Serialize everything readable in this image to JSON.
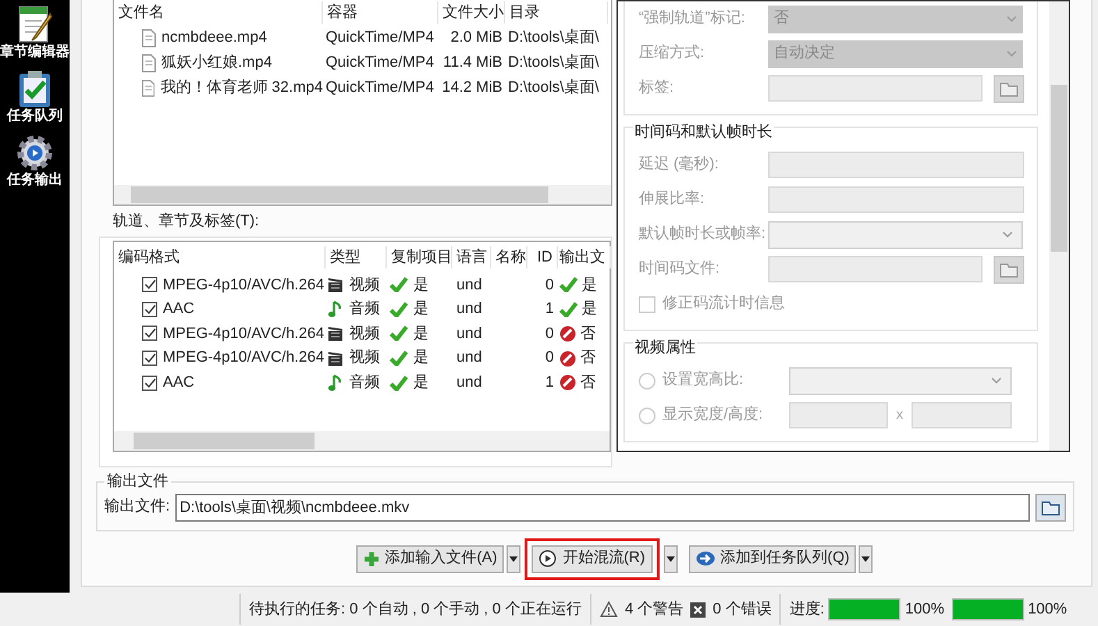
{
  "sidebar": {
    "items": [
      {
        "label": "章节编辑器",
        "kind": "notepad"
      },
      {
        "label": "任务队列",
        "kind": "queue"
      },
      {
        "label": "任务输出",
        "kind": "output"
      }
    ]
  },
  "files": {
    "columns": [
      "文件名",
      "容器",
      "文件大小",
      "目录"
    ],
    "rows": [
      {
        "name": "ncmbdeee.mp4",
        "container": "QuickTime/MP4",
        "size": "2.0 MiB",
        "dir": "D:\\tools\\桌面\\"
      },
      {
        "name": "狐妖小红娘.mp4",
        "container": "QuickTime/MP4",
        "size": "11.4 MiB",
        "dir": "D:\\tools\\桌面\\"
      },
      {
        "name": "我的！体育老师 32.mp4",
        "container": "QuickTime/MP4",
        "size": "14.2 MiB",
        "dir": "D:\\tools\\桌面\\"
      }
    ]
  },
  "tracks": {
    "label": "轨道、章节及标签(T):",
    "columns": [
      "编码格式",
      "类型",
      "复制项目",
      "语言",
      "名称",
      "ID",
      "输出文"
    ],
    "rows": [
      {
        "checked": true,
        "codec": "MPEG-4p10/AVC/h.264",
        "kind": "video",
        "type": "视频",
        "copy": "是",
        "copy_on": true,
        "language": "und",
        "id": "0",
        "output": "是",
        "output_on": true
      },
      {
        "checked": true,
        "codec": "AAC",
        "kind": "audio",
        "type": "音频",
        "copy": "是",
        "copy_on": true,
        "language": "und",
        "id": "1",
        "output": "是",
        "output_on": true
      },
      {
        "checked": true,
        "codec": "MPEG-4p10/AVC/h.264",
        "kind": "video",
        "type": "视频",
        "copy": "是",
        "copy_on": true,
        "language": "und",
        "id": "0",
        "output": "否",
        "output_on": false
      },
      {
        "checked": true,
        "codec": "MPEG-4p10/AVC/h.264",
        "kind": "video",
        "type": "视频",
        "copy": "是",
        "copy_on": true,
        "language": "und",
        "id": "0",
        "output": "否",
        "output_on": false
      },
      {
        "checked": true,
        "codec": "AAC",
        "kind": "audio",
        "type": "音频",
        "copy": "是",
        "copy_on": true,
        "language": "und",
        "id": "1",
        "output": "否",
        "output_on": false
      }
    ]
  },
  "properties": {
    "sections": [
      {
        "rows": [
          {
            "kind": "select",
            "label": "“强制轨道”标记:",
            "value": "否"
          },
          {
            "kind": "select",
            "label": "压缩方式:",
            "value": "自动决定"
          },
          {
            "kind": "file",
            "label": "标签:"
          }
        ]
      },
      {
        "title": "时间码和默认帧时长",
        "rows": [
          {
            "kind": "input",
            "label": "延迟 (毫秒):"
          },
          {
            "kind": "input",
            "label": "伸展比率:"
          },
          {
            "kind": "combo",
            "label": "默认帧时长或帧率:"
          },
          {
            "kind": "file",
            "label": "时间码文件:"
          },
          {
            "kind": "checkbox",
            "label": "修正码流计时信息",
            "checked": false
          }
        ]
      },
      {
        "title": "视频属性",
        "rows": [
          {
            "kind": "radio_combo",
            "label": "设置宽高比:",
            "selected": false
          },
          {
            "kind": "radio_pair",
            "label": "显示宽度/高度:",
            "selected": false,
            "separator": "x"
          }
        ]
      }
    ]
  },
  "output": {
    "group_title": "输出文件",
    "label": "输出文件:",
    "value": "D:\\tools\\桌面\\视频\\ncmbdeee.mkv"
  },
  "actions": [
    {
      "label": "添加输入文件(A)",
      "kind": "add",
      "highlighted": false
    },
    {
      "label": "开始混流(R)",
      "kind": "start",
      "highlighted": true
    },
    {
      "label": "添加到任务队列(Q)",
      "kind": "queue",
      "highlighted": false
    }
  ],
  "status_bar": {
    "pending": "待执行的任务: 0 个自动 , 0 个手动 , 0 个正在运行",
    "warnings": "4 个警告",
    "errors": "0 个错误",
    "progress_label": "进度:",
    "progress": [
      {
        "level": 1,
        "reading": "100%"
      },
      {
        "level": 1,
        "reading": "100%"
      }
    ]
  }
}
